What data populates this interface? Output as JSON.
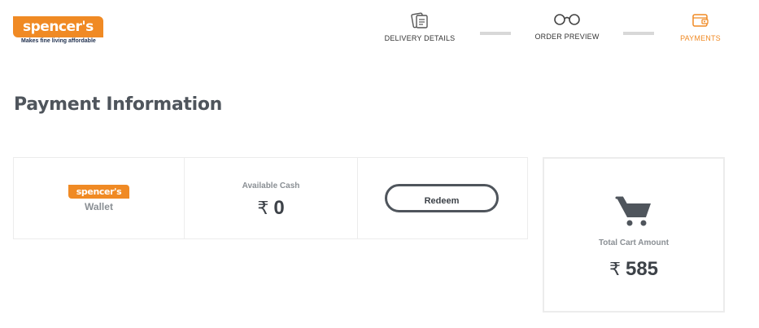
{
  "brand": {
    "logo_text": "spencer's",
    "tagline": "Makes fine living affordable",
    "accent_color": "#f08a24"
  },
  "steps": [
    {
      "label": "DELIVERY DETAILS",
      "icon": "delivery-form-icon",
      "active": false
    },
    {
      "label": "ORDER PREVIEW",
      "icon": "glasses-icon",
      "active": false
    },
    {
      "label": "PAYMENTS",
      "icon": "wallet-icon",
      "active": true
    }
  ],
  "page_title": "Payment Information",
  "wallet": {
    "brand_text": "spencer's",
    "label": "Wallet",
    "available_cash_label": "Available Cash",
    "currency_symbol": "₹",
    "available_cash_value": "0",
    "redeem_label": "Redeem"
  },
  "cart": {
    "icon": "cart-icon",
    "total_label": "Total Cart Amount",
    "currency_symbol": "₹",
    "total_value": "585"
  }
}
